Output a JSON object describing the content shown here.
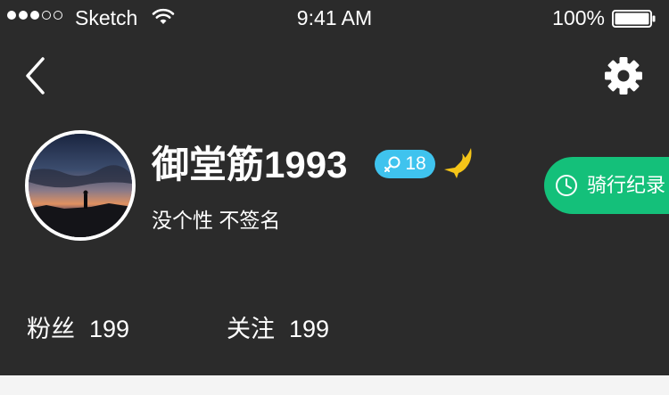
{
  "status_bar": {
    "carrier": "Sketch",
    "time": "9:41 AM",
    "battery": "100%",
    "icons": [
      "signal-dots-icon",
      "wifi-icon",
      "battery-icon"
    ]
  },
  "nav": {
    "back_icon": "chevron-left-icon",
    "settings_icon": "gear-icon"
  },
  "profile": {
    "username": "御堂筋1993",
    "age": "18",
    "gender_icon": "female-icon",
    "level_icon": "bird-icon",
    "signature": "没个性 不签名"
  },
  "ride_record": {
    "label": "骑行纪录",
    "icon": "clock-icon"
  },
  "stats": {
    "followers_label": "粉丝",
    "followers_value": "199",
    "following_label": "关注",
    "following_value": "199"
  },
  "colors": {
    "background": "#2b2b2b",
    "ride_button": "#14c07a",
    "gender_badge": "#3fc3ee",
    "bird": "#f5c518"
  }
}
